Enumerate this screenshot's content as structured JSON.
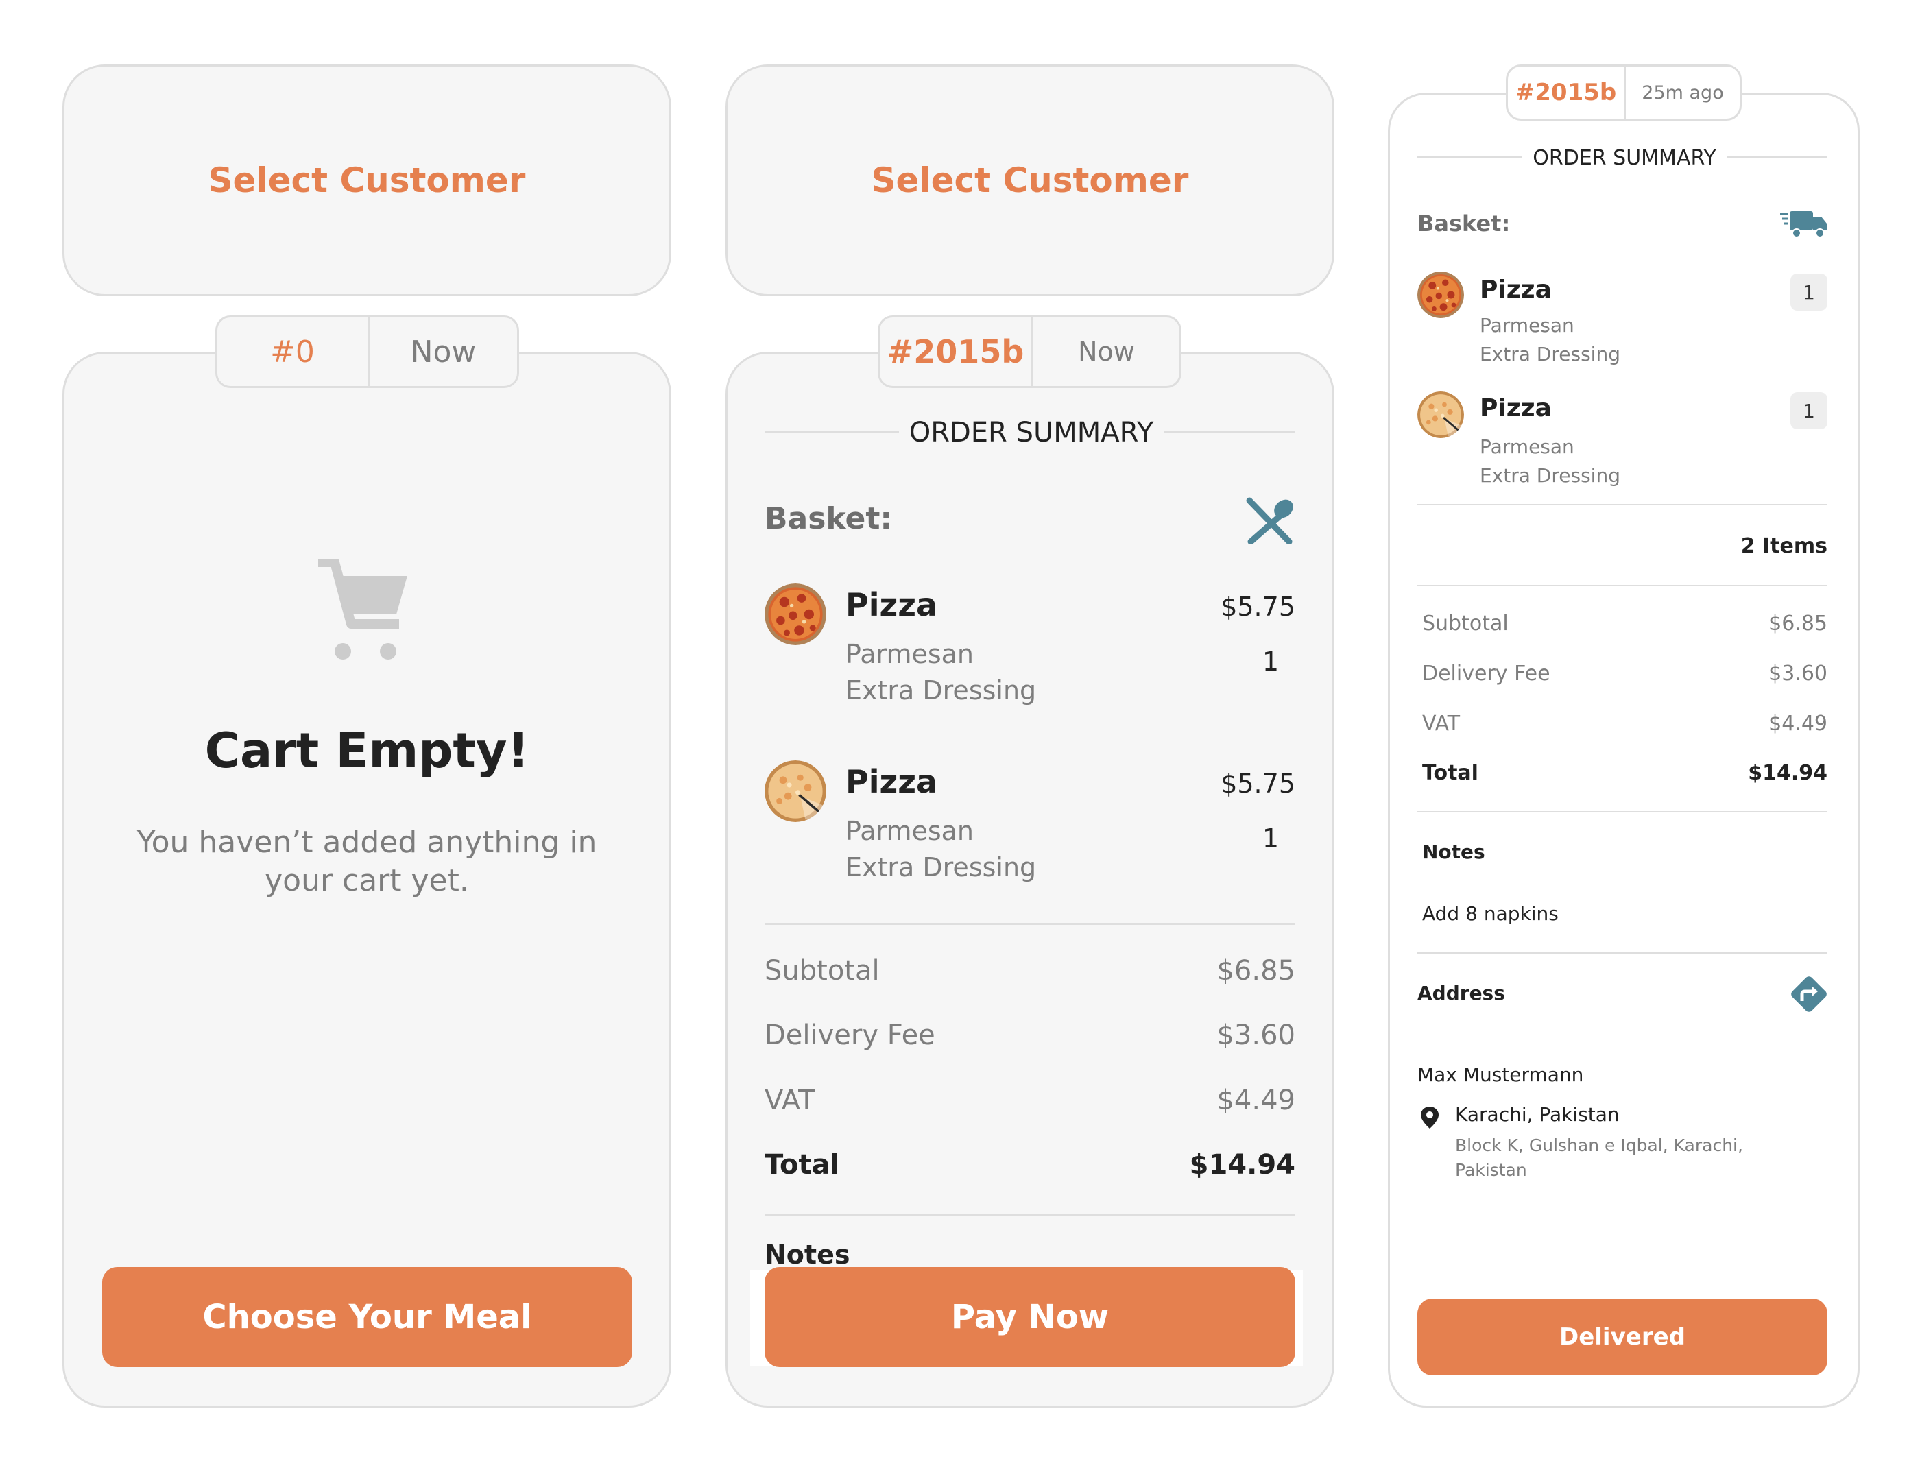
{
  "colors": {
    "accent": "#e5804f",
    "icon_teal": "#4f8597",
    "muted": "#7d7d7d"
  },
  "screen1": {
    "select_customer": "Select Customer",
    "order_number": "#0",
    "order_time": "Now",
    "empty_icon": "cart-icon",
    "empty_title": "Cart Empty!",
    "empty_message_line1": "You haven’t added anything in",
    "empty_message_line2": "your cart yet.",
    "button_label": "Choose Your Meal"
  },
  "screen2": {
    "select_customer": "Select Customer",
    "order_number": "#2015b",
    "order_time": "Now",
    "section_title": "ORDER SUMMARY",
    "basket_label": "Basket:",
    "basket_icon": "utensils-icon",
    "items": [
      {
        "name": "Pizza",
        "options": [
          "Parmesan",
          "Extra Dressing"
        ],
        "price": "$5.75",
        "qty": "1"
      },
      {
        "name": "Pizza",
        "options": [
          "Parmesan",
          "Extra Dressing"
        ],
        "price": "$5.75",
        "qty": "1"
      }
    ],
    "totals": {
      "subtotal_label": "Subtotal",
      "subtotal": "$6.85",
      "delivery_label": "Delivery Fee",
      "delivery": "$3.60",
      "vat_label": "VAT",
      "vat": "$4.49",
      "total_label": "Total",
      "total": "$14.94"
    },
    "notes_label": "Notes",
    "button_label": "Pay Now"
  },
  "screen3": {
    "order_number": "#2015b",
    "order_time": "25m ago",
    "section_title": "ORDER SUMMARY",
    "basket_label": "Basket:",
    "basket_icon": "delivery-truck-icon",
    "items": [
      {
        "name": "Pizza",
        "options": [
          "Parmesan",
          "Extra Dressing"
        ],
        "qty": "1"
      },
      {
        "name": "Pizza",
        "options": [
          "Parmesan",
          "Extra Dressing"
        ],
        "qty": "1"
      }
    ],
    "items_count": "2 Items",
    "totals": {
      "subtotal_label": "Subtotal",
      "subtotal": "$6.85",
      "delivery_label": "Delivery Fee",
      "delivery": "$3.60",
      "vat_label": "VAT",
      "vat": "$4.49",
      "total_label": "Total",
      "total": "$14.94"
    },
    "notes_label": "Notes",
    "notes_text": "Add 8 napkins",
    "address_label": "Address",
    "directions_icon": "directions-icon",
    "customer_name": "Max Mustermann",
    "city": "Karachi, Pakistan",
    "street_line1": "Block K, Gulshan e Iqbal, Karachi,",
    "street_line2": "Pakistan",
    "button_label": "Delivered"
  }
}
